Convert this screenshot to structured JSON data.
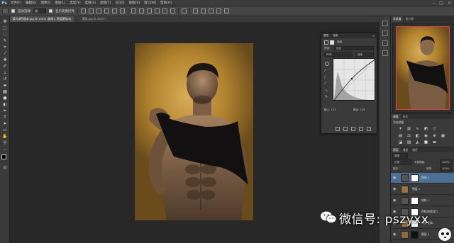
{
  "app": {
    "logo": "Ps",
    "menu": [
      "文件(F)",
      "编辑(E)",
      "图像(I)",
      "图层(L)",
      "类型(Y)",
      "选择(S)",
      "滤镜(T)",
      "3D(D)",
      "视图(V)",
      "窗口(W)",
      "帮助(H)"
    ]
  },
  "options_bar": {
    "auto_select_label": "自动选择",
    "auto_select_target": "组",
    "show_transform_label": "显示变换控件"
  },
  "document_tabs": [
    {
      "label": "柔光调色副本.jpg @ 100% (曲线1, 图层蒙版/8)",
      "active": true
    },
    {
      "label": "腹肌.jpg @ 100%",
      "active": false
    }
  ],
  "properties_panel": {
    "tabs": [
      "属性",
      "信息"
    ],
    "title": "曲线",
    "preset_label": "预设:",
    "preset_value": "自定",
    "channel_value": "RGB",
    "auto_button": "自动",
    "input_label": "输入: 111",
    "output_label": "输出: 135"
  },
  "navigator": {
    "tabs": [
      "导航器",
      "直方图"
    ]
  },
  "adjustments_panel": {
    "tabs": [
      "调整",
      "样式"
    ],
    "subtitle": "添加调整"
  },
  "layers_panel": {
    "tabs": [
      "图层",
      "通道",
      "路径"
    ],
    "kind_filter": "类型",
    "blend_mode": "正常",
    "opacity_label": "不透明度:",
    "opacity_value": "100%",
    "lock_label": "锁定:",
    "fill_label": "填充:",
    "fill_value": "100%",
    "layers": [
      {
        "name": "曲线 2",
        "selected": true
      },
      {
        "name": "图层 1",
        "selected": false
      },
      {
        "name": "曲线 1",
        "selected": false
      },
      {
        "name": "色相/饱和度 1",
        "selected": false
      },
      {
        "name": "背景 副本",
        "selected": false
      },
      {
        "name": "图层 0",
        "selected": false
      }
    ]
  },
  "watermark": {
    "text": "微信号: pszyxx"
  },
  "colors": {
    "selection_blue": "#4c6f93",
    "panel_bg": "#3a3a3a",
    "canvas_bg": "#282828"
  }
}
